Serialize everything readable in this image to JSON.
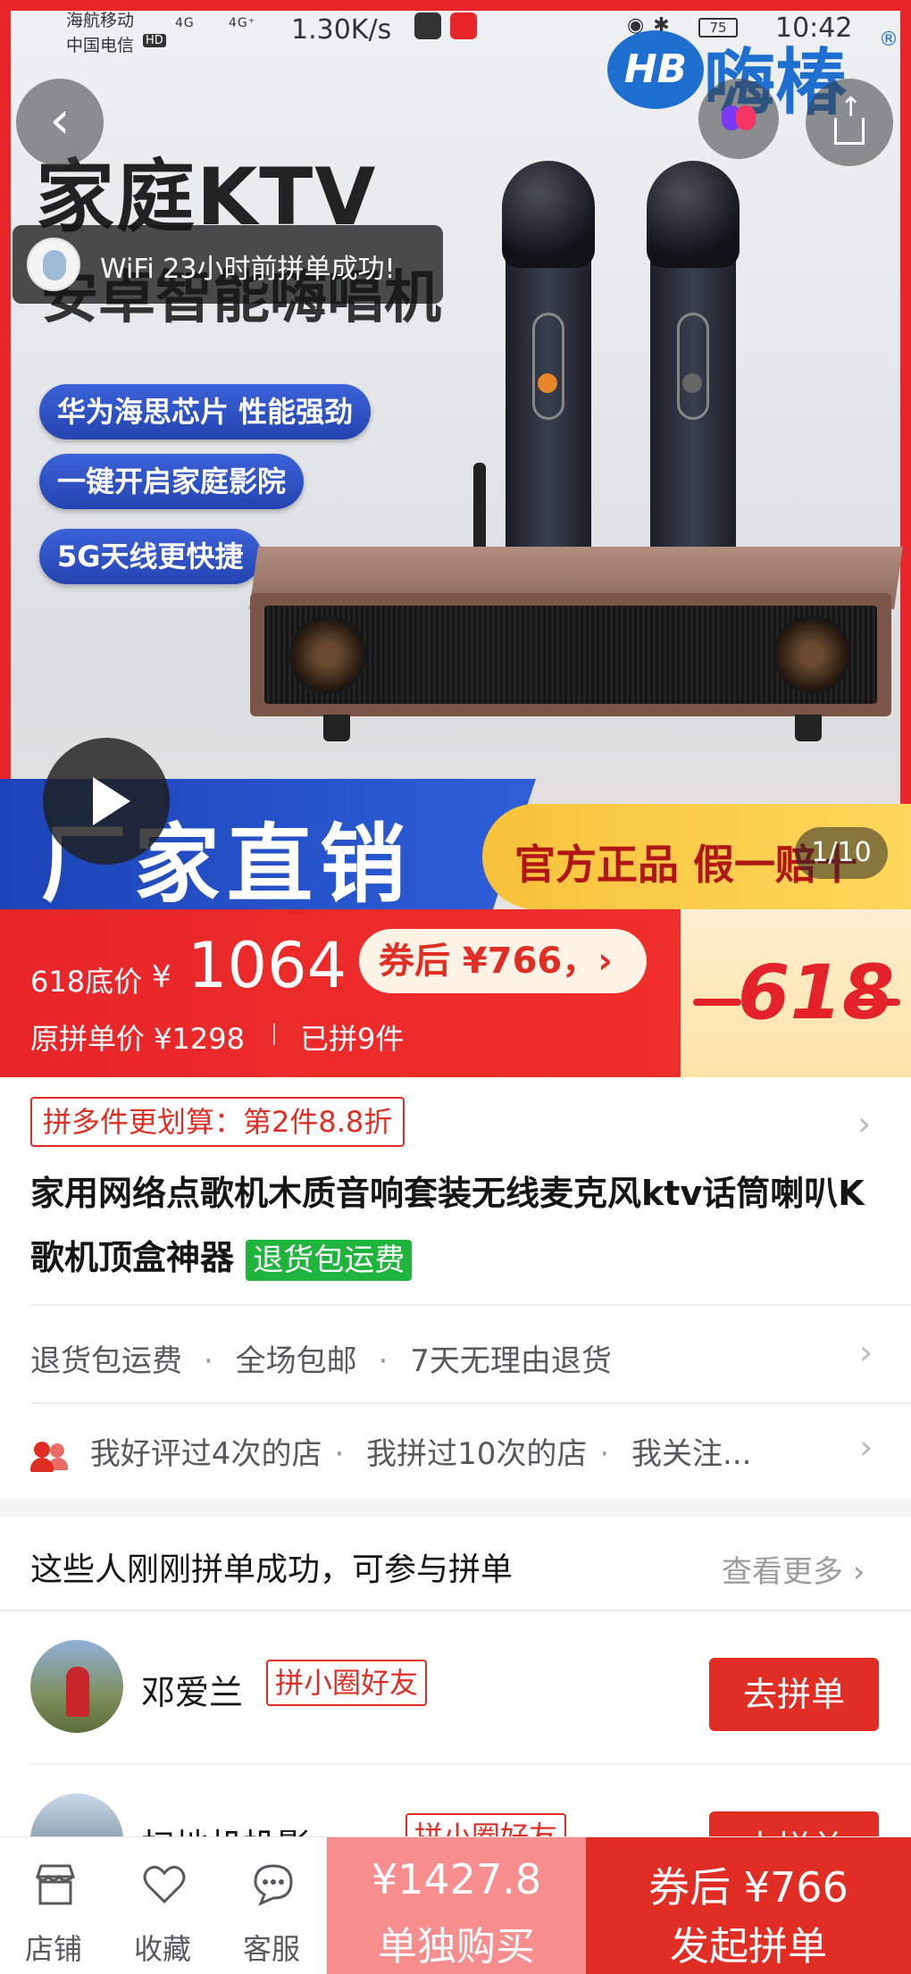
{
  "status_bar": {
    "carrier1": "海航移动",
    "carrier2": "中国电信",
    "hd": "HD",
    "net1": "4G",
    "net2": "4G⁺",
    "speed": "1.30K/s",
    "battery": "75",
    "time": "10:42"
  },
  "hero": {
    "logo_text": "HB",
    "logo_brand": "嗨椿",
    "logo_reg": "®",
    "title": "家庭KTV",
    "subtitle": "安卓智能嗨唱机",
    "features": [
      "华为海思芯片 性能强劲",
      "一键开启家庭影院",
      "5G天线更快捷"
    ],
    "toast": "WiFi 23小时前拼单成功!",
    "band_text": "厂家直销",
    "gold_text": "官方正品 假一赔十",
    "counter": "1/10",
    "back_icon": "‹"
  },
  "price": {
    "label": "618底价",
    "symbol": "¥",
    "value": "1064",
    "coupon": "券后 ¥766，›",
    "original": "原拼单价 ¥1298",
    "sold": "已拼9件",
    "badge": "618"
  },
  "promo": {
    "text": "拼多件更划算：第2件8.8折"
  },
  "product": {
    "title": "家用网络点歌机木质音响套装无线麦克风ktv话筒喇叭K歌机顶盒神器",
    "tag": "退货包运费"
  },
  "services": [
    "退货包运费",
    "全场包邮",
    "7天无理由退货"
  ],
  "shop_info": [
    "我好评过4次的店",
    "我拼过10次的店",
    "我关注..."
  ],
  "group": {
    "heading": "这些人刚刚拼单成功，可参与拼单",
    "more": "查看更多",
    "members": [
      {
        "name": "邓爱兰",
        "tag": "拼小圈好友",
        "action": "去拼单"
      },
      {
        "name": "扫地机投影",
        "tag": "拼小圈好友",
        "action": "去拼单"
      }
    ]
  },
  "bottom": {
    "tabs": [
      {
        "label": "店铺",
        "icon": "store-icon"
      },
      {
        "label": "收藏",
        "icon": "heart-icon"
      },
      {
        "label": "客服",
        "icon": "chat-icon"
      }
    ],
    "alone_price": "¥1427.8",
    "alone_label": "单独购买",
    "group_price": "券后 ¥766",
    "group_label": "发起拼单"
  },
  "colors": {
    "accent": "#e02e24",
    "green_tag": "#1fb53d",
    "band_blue": "#2448c0"
  }
}
